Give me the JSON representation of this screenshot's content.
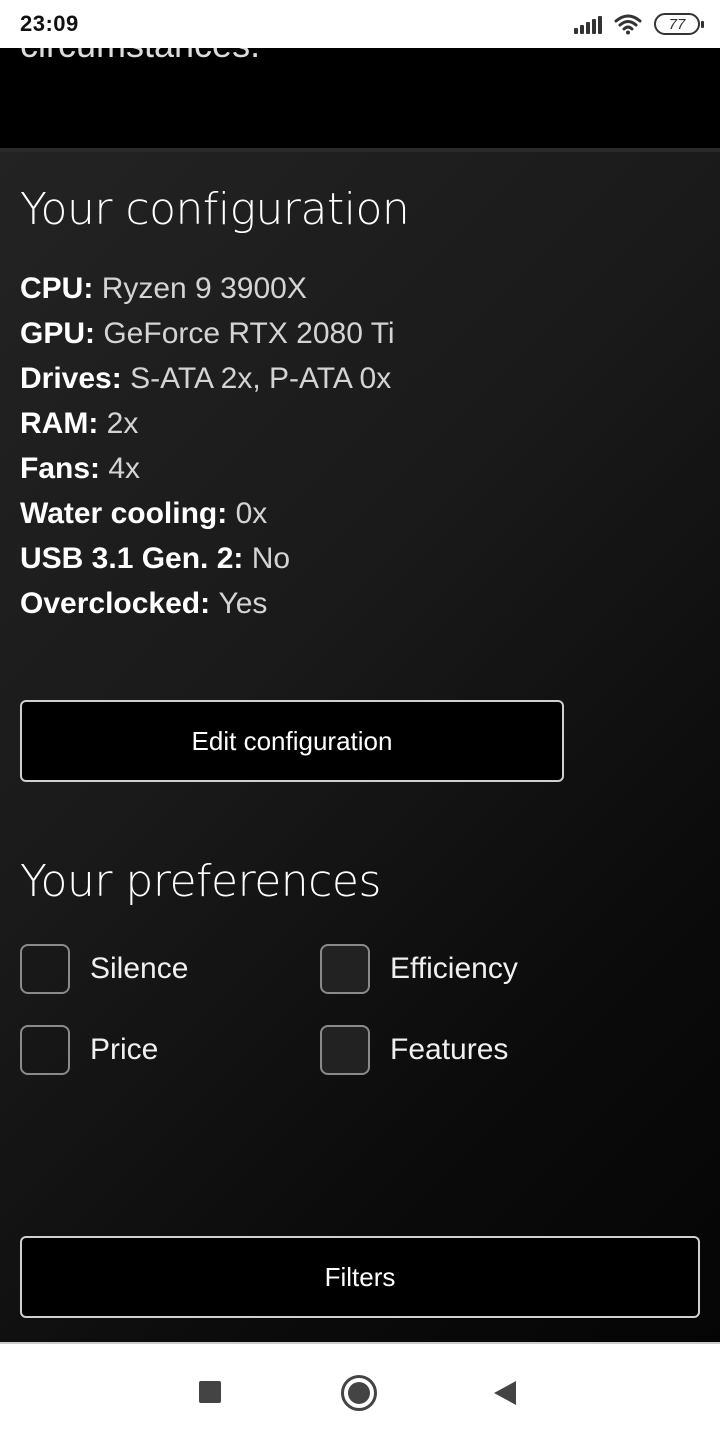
{
  "status_bar": {
    "time": "23:09",
    "battery": "77",
    "icons": [
      "signal-icon",
      "wifi-icon",
      "battery-icon"
    ]
  },
  "top_snippet": "circumstances.",
  "configuration": {
    "title": "Your configuration",
    "specs": [
      {
        "label": "CPU:",
        "value": "Ryzen 9 3900X"
      },
      {
        "label": "GPU:",
        "value": "GeForce RTX 2080 Ti"
      },
      {
        "label": "Drives:",
        "value": "S-ATA 2x, P-ATA 0x"
      },
      {
        "label": "RAM:",
        "value": "2x"
      },
      {
        "label": "Fans:",
        "value": "4x"
      },
      {
        "label": "Water cooling:",
        "value": "0x"
      },
      {
        "label": "USB 3.1 Gen. 2:",
        "value": "No"
      },
      {
        "label": "Overclocked:",
        "value": "Yes"
      }
    ],
    "edit_button": "Edit configuration"
  },
  "preferences": {
    "title": "Your preferences",
    "options": [
      {
        "label": "Silence",
        "checked": false
      },
      {
        "label": "Efficiency",
        "checked": false
      },
      {
        "label": "Price",
        "checked": false
      },
      {
        "label": "Features",
        "checked": false
      }
    ]
  },
  "filters_button": "Filters",
  "nav_bar": {
    "icons": [
      "recent-apps-icon",
      "home-icon",
      "back-icon"
    ]
  },
  "colors": {
    "background": "#000000",
    "panel_gradient_start": "#232323",
    "text": "#ffffff",
    "button_border": "#cfcfcf"
  }
}
